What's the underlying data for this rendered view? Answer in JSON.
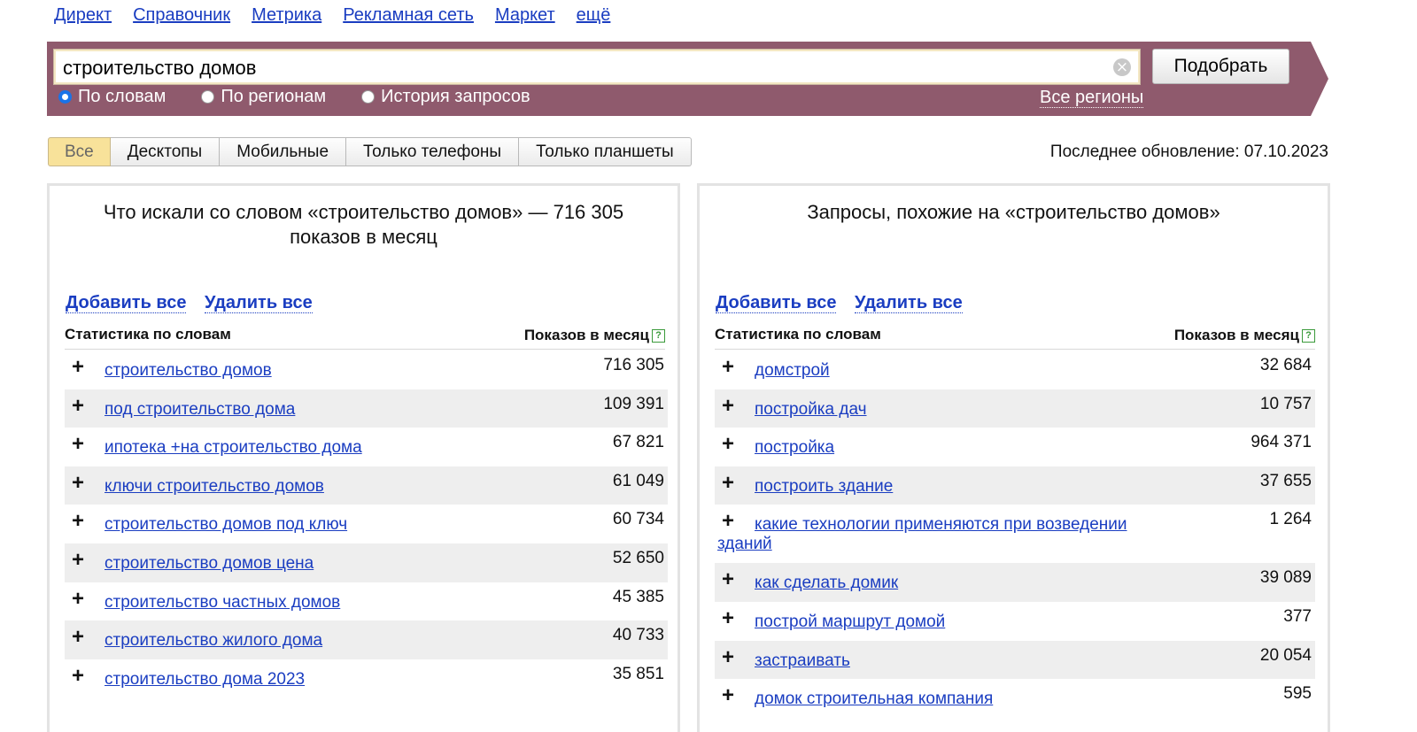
{
  "nav": {
    "services": [
      "Директ",
      "Справочник",
      "Метрика",
      "Рекламная сеть",
      "Маркет",
      "ещё"
    ]
  },
  "search": {
    "query": "строительство домов",
    "submit_label": "Подобрать",
    "modes": [
      {
        "label": "По словам",
        "checked": true
      },
      {
        "label": "По регионам",
        "checked": false
      },
      {
        "label": "История запросов",
        "checked": false
      }
    ],
    "regions_label": "Все регионы"
  },
  "device_tabs": [
    "Все",
    "Десктопы",
    "Мобильные",
    "Только телефоны",
    "Только планшеты"
  ],
  "active_tab": "Все",
  "last_update": "Последнее обновление: 07.10.2023",
  "left_panel": {
    "title": "Что искали со словом «строительство домов» — 716 305 показов в месяц",
    "add_all": "Добавить все",
    "remove_all": "Удалить все",
    "col_words": "Статистика по словам",
    "col_count": "Показов в месяц",
    "rows": [
      {
        "phrase": "строительство домов",
        "count": "716 305"
      },
      {
        "phrase": "под строительство дома",
        "count": "109 391"
      },
      {
        "phrase": "ипотека +на строительство дома",
        "count": "67 821"
      },
      {
        "phrase": "ключи строительство домов",
        "count": "61 049"
      },
      {
        "phrase": "строительство домов под ключ",
        "count": "60 734"
      },
      {
        "phrase": "строительство домов цена",
        "count": "52 650"
      },
      {
        "phrase": "строительство частных домов",
        "count": "45 385"
      },
      {
        "phrase": "строительство жилого дома",
        "count": "40 733"
      },
      {
        "phrase": "строительство дома 2023",
        "count": "35 851"
      }
    ]
  },
  "right_panel": {
    "title": "Запросы, похожие на «строительство домов»",
    "add_all": "Добавить все",
    "remove_all": "Удалить все",
    "col_words": "Статистика по словам",
    "col_count": "Показов в месяц",
    "rows": [
      {
        "phrase": "домстрой",
        "count": "32 684"
      },
      {
        "phrase": "постройка дач",
        "count": "10 757"
      },
      {
        "phrase": "постройка",
        "count": "964 371"
      },
      {
        "phrase": "построить здание",
        "count": "37 655"
      },
      {
        "phrase": "какие технологии применяются при возведении зданий",
        "count": "1 264"
      },
      {
        "phrase": "как сделать домик",
        "count": "39 089"
      },
      {
        "phrase": "построй маршрут домой",
        "count": "377"
      },
      {
        "phrase": "застраивать",
        "count": "20 054"
      },
      {
        "phrase": "домок строительная компания",
        "count": "595"
      }
    ]
  }
}
